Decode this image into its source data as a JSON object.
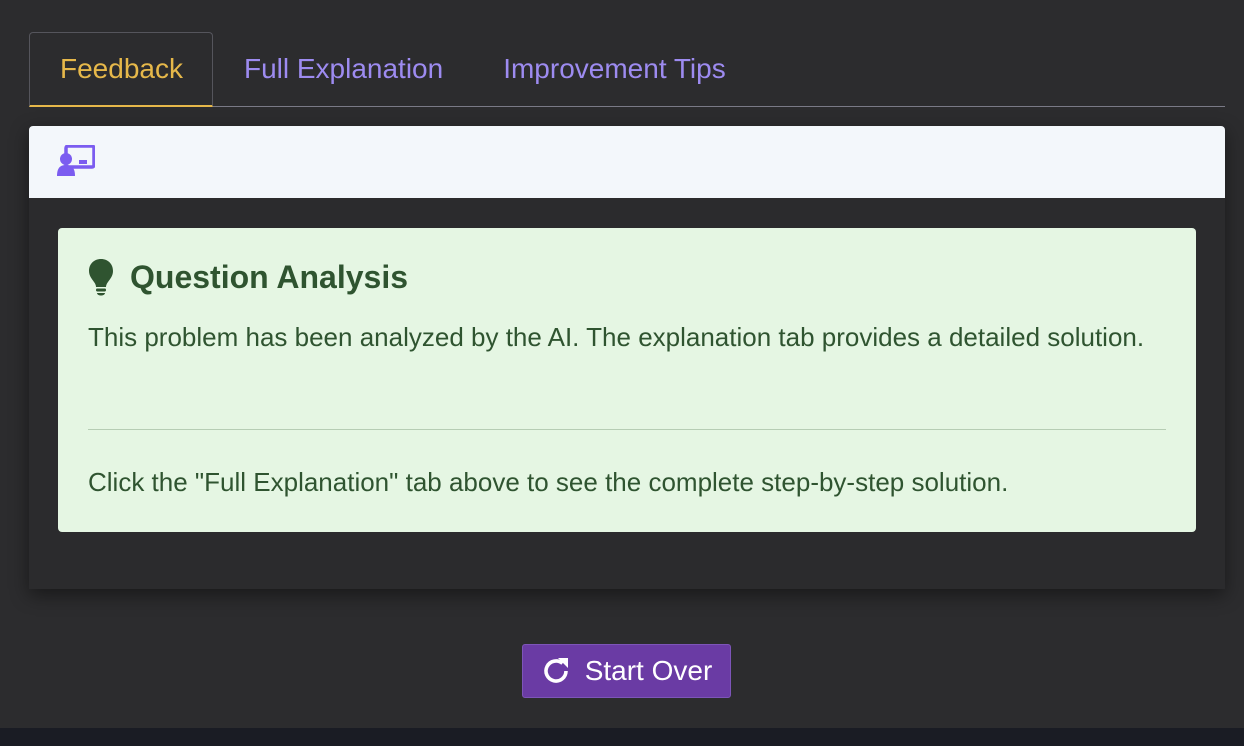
{
  "tabs": [
    {
      "label": "Feedback",
      "active": true
    },
    {
      "label": "Full Explanation",
      "active": false
    },
    {
      "label": "Improvement Tips",
      "active": false
    }
  ],
  "panel": {
    "header_icon": "chalkboard-teacher-icon"
  },
  "analysis": {
    "icon": "lightbulb-icon",
    "title": "Question Analysis",
    "text": "This problem has been analyzed by the AI. The explanation tab provides a detailed solution.",
    "hint": "Click the \"Full Explanation\" tab above to see the complete step-by-step solution."
  },
  "actions": {
    "start_over_label": "Start Over",
    "start_over_icon": "redo-icon"
  },
  "colors": {
    "active_tab": "#e6b84a",
    "inactive_tab": "#9d8bf0",
    "analysis_bg": "#e5f6e3",
    "analysis_text": "#2f5430",
    "button_bg": "#6a3ba4",
    "page_bg": "#2c2c2e"
  }
}
